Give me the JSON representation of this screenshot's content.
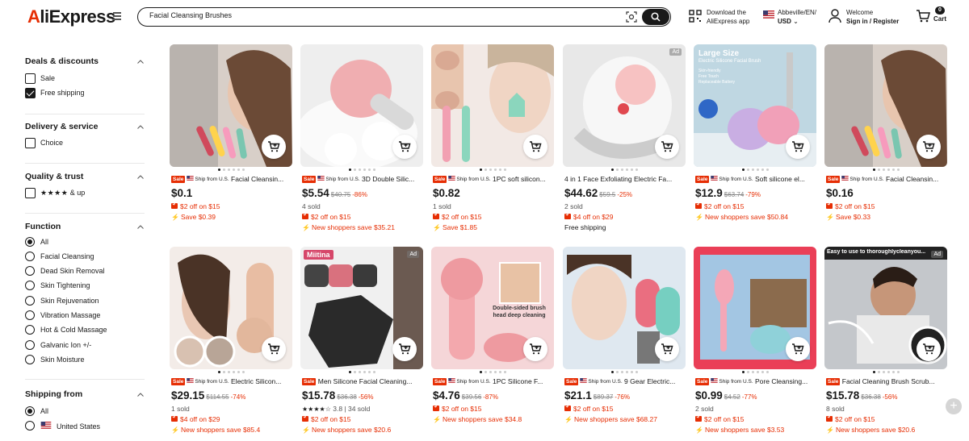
{
  "header": {
    "logo_prefix": "A",
    "logo_rest": "liExpress",
    "search_value": "Facial Cleansing Brushes",
    "app_line1": "Download the",
    "app_line2": "AliExpress app",
    "region_line1": "Abbeville/EN/",
    "region_line2": "USD",
    "welcome_line1": "Welcome",
    "welcome_line2": "Sign in / Register",
    "cart_count": "0",
    "cart_label": "Cart"
  },
  "sidebar": {
    "deals_title": "Deals & discounts",
    "sale": "Sale",
    "free_shipping": "Free shipping",
    "delivery_title": "Delivery & service",
    "choice": "Choice",
    "quality_title": "Quality & trust",
    "stars": "★★★★",
    "and_up": "& up",
    "function_title": "Function",
    "functions": [
      "All",
      "Facial Cleansing",
      "Dead Skin Removal",
      "Skin Tightening",
      "Skin Rejuvenation",
      "Vibration Massage",
      "Hot & Cold Massage",
      "Galvanic Ion +/-",
      "Skin Moisture"
    ],
    "shipping_title": "Shipping from",
    "ship_all": "All",
    "ship_us": "United States"
  },
  "colors": {
    "accent": "#e62e04",
    "text": "#191919"
  },
  "products": [
    {
      "sale": "Sale",
      "ship": "Ship from U.S.",
      "title": "Facial Cleansin...",
      "price": "$0.1",
      "orig": "",
      "disc": "",
      "l1": "$2 off on $15",
      "l2": "Save $0.39",
      "l3": ""
    },
    {
      "sale": "Sale",
      "ship": "Ship from U.S.",
      "title": "3D Double Silic...",
      "price": "$5.54",
      "orig": "$40.75",
      "disc": "-86%",
      "l0": "4 sold",
      "l1": "$2 off on $15",
      "l2": "New shoppers save $35.21",
      "l3": ""
    },
    {
      "sale": "Sale",
      "ship": "Ship from U.S.",
      "title": "1PC soft silicon...",
      "price": "$0.82",
      "orig": "",
      "disc": "",
      "l0": "1 sold",
      "l1": "$2 off on $15",
      "l2": "Save $1.85",
      "l3": ""
    },
    {
      "sale": "",
      "ship": "",
      "title": "4 in 1 Face Exfoliating Electric Fa...",
      "price": "$44.62",
      "orig": "$59.5",
      "disc": "-25%",
      "l0": "2 sold",
      "l1": "$4 off on $29",
      "l2": "",
      "l3": "Free shipping"
    },
    {
      "sale": "Sale",
      "ship": "Ship from U.S.",
      "title": "Soft silicone el...",
      "price": "$12.9",
      "orig": "$63.74",
      "disc": "-79%",
      "l1": "$2 off on $15",
      "l2": "New shoppers save $50.84",
      "l3": ""
    },
    {
      "sale": "Sale",
      "ship": "Ship from U.S.",
      "title": "Facial Cleansin...",
      "price": "$0.16",
      "orig": "",
      "disc": "",
      "l1": "$2 off on $15",
      "l2": "Save $0.33",
      "l3": ""
    },
    {
      "sale": "Sale",
      "ship": "Ship from U.S.",
      "title": "Electric Silicon...",
      "price": "$29.15",
      "orig": "$114.55",
      "disc": "-74%",
      "l0": "1 sold",
      "l1": "$4 off on $29",
      "l2": "New shoppers save $85.4",
      "l3": ""
    },
    {
      "sale": "Sale",
      "ship": "",
      "title": "Men Silicone Facial Cleaning...",
      "price": "$15.78",
      "orig": "$36.38",
      "disc": "-56%",
      "l0": "3.8 | 34 sold",
      "l1": "$2 off on $15",
      "l2": "New shoppers save $20.6",
      "l3": "",
      "ad": "Ad",
      "brand": "Miitina"
    },
    {
      "sale": "Sale",
      "ship": "Ship from U.S.",
      "title": "1PC Silicone F...",
      "price": "$4.76",
      "orig": "$39.56",
      "disc": "-87%",
      "l1": "$2 off on $15",
      "l2": "New shoppers save $34.8",
      "l3": "",
      "img_text": "Double-sided brush head deep cleaning"
    },
    {
      "sale": "Sale",
      "ship": "Ship from U.S.",
      "title": "9 Gear Electric...",
      "price": "$21.1",
      "orig": "$89.37",
      "disc": "-76%",
      "l1": "$2 off on $15",
      "l2": "New shoppers save $68.27",
      "l3": ""
    },
    {
      "sale": "Sale",
      "ship": "Ship from U.S.",
      "title": "Pore Cleansing...",
      "price": "$0.99",
      "orig": "$4.52",
      "disc": "-77%",
      "l0": "2 sold",
      "l1": "$2 off on $15",
      "l2": "New shoppers save $3.53",
      "l3": ""
    },
    {
      "sale": "Sale",
      "ship": "",
      "title": "Facial Cleaning Brush Scrub...",
      "price": "$15.78",
      "orig": "$36.38",
      "disc": "-56%",
      "l0": "8 sold",
      "l1": "$2 off on $15",
      "l2": "New shoppers save $20.6",
      "l3": "",
      "ad": "Ad",
      "img_text": "Easy to use to thoroughlycleanyou..."
    }
  ],
  "product4_ad": "Ad",
  "product5_text": {
    "t1": "Large Size",
    "t2": "Electric Silicone Facial Brush",
    "t3": "Skin-friendly",
    "t4": "Free Touch",
    "t5": "Replaceable Battery"
  }
}
